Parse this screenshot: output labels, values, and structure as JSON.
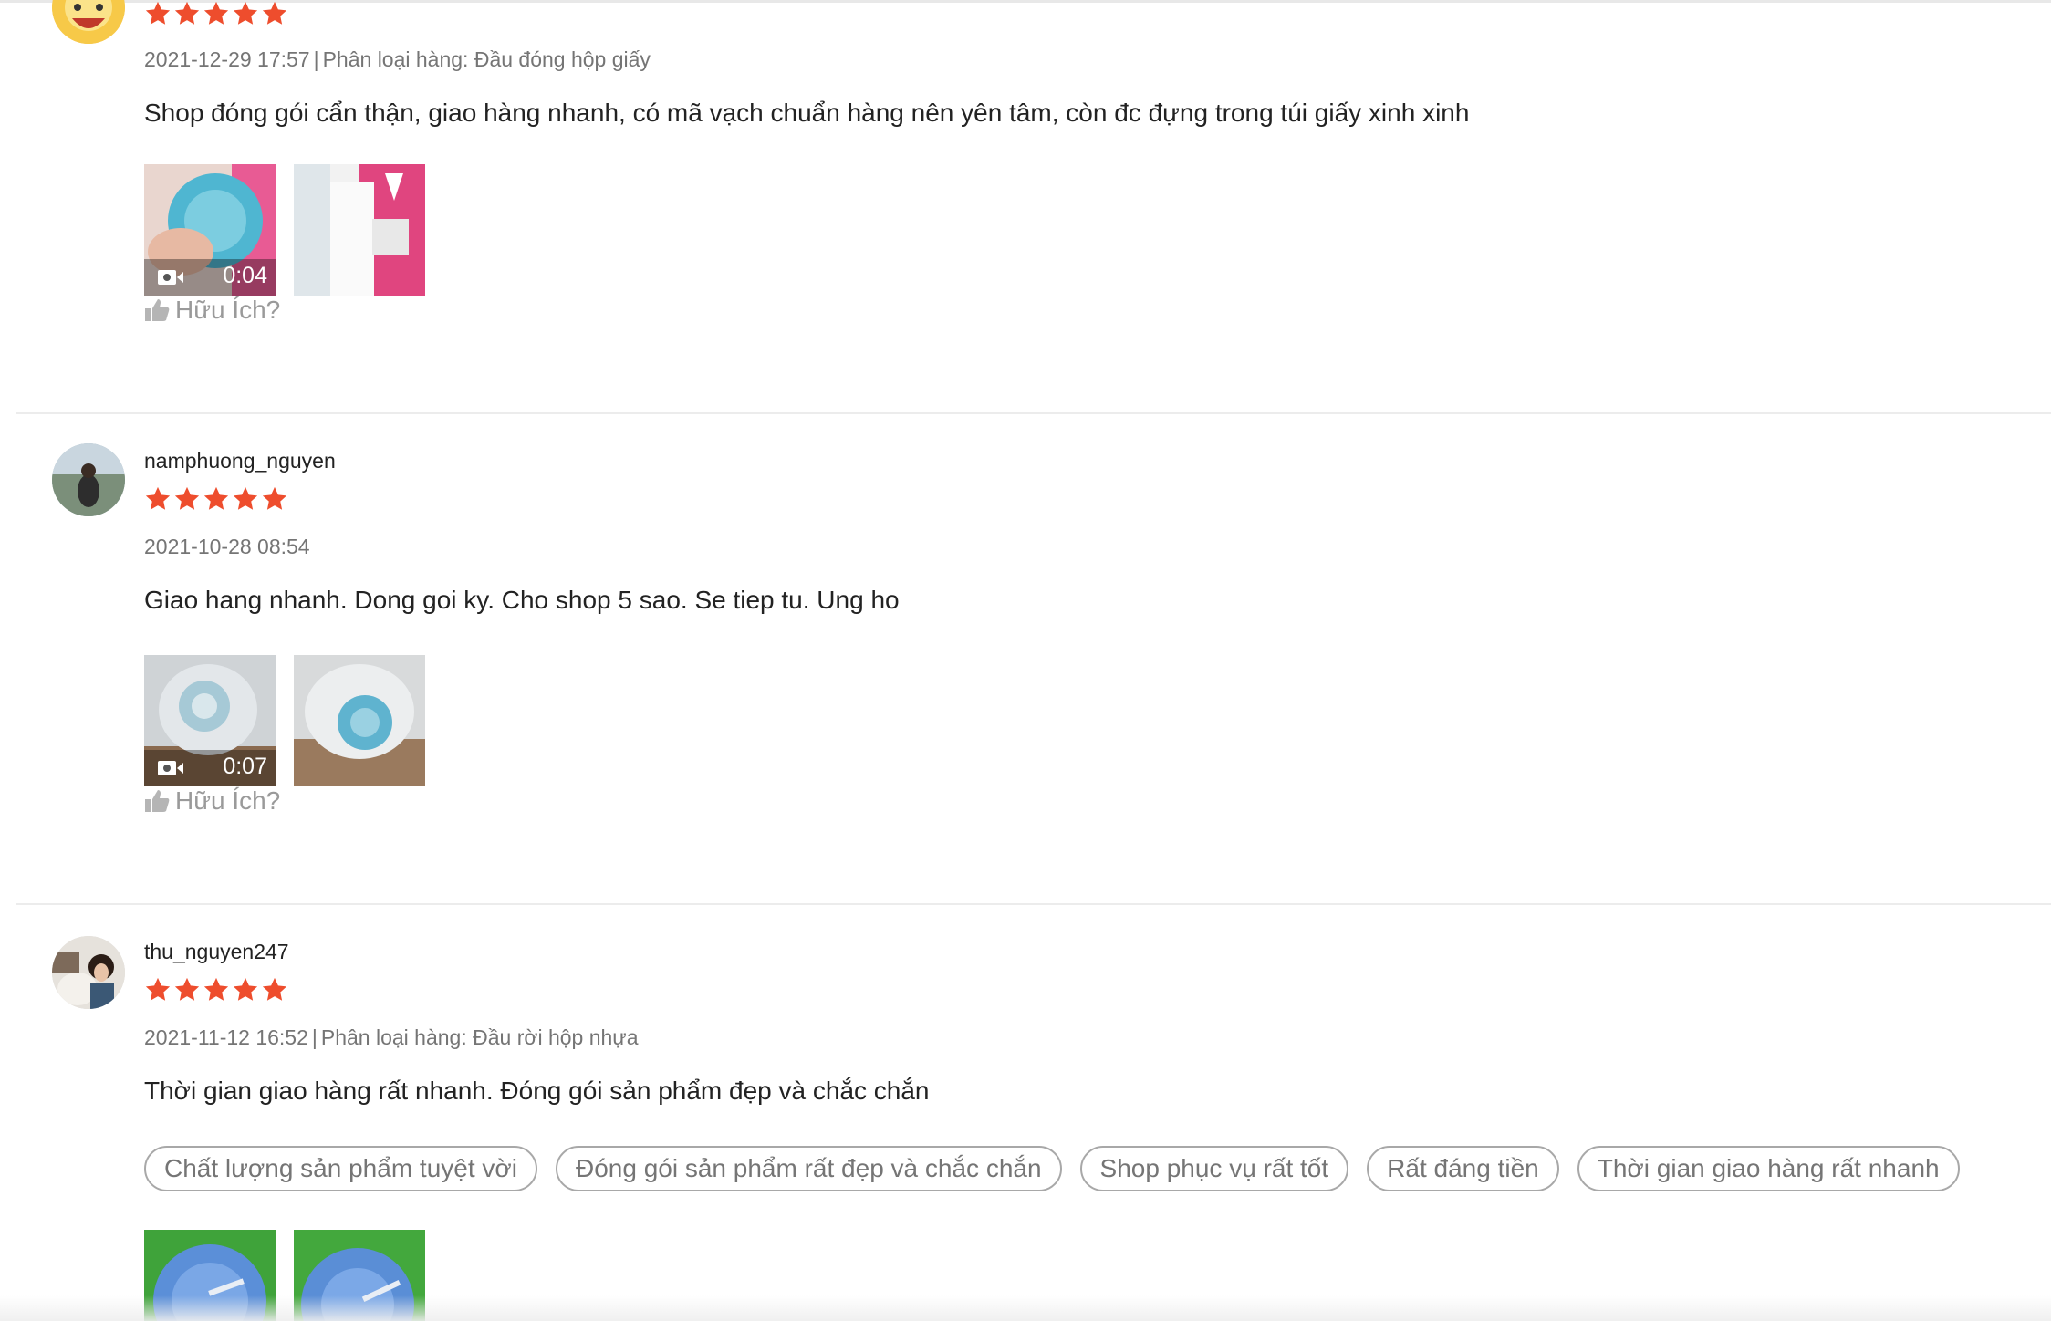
{
  "colors": {
    "star": "#ee4d2d",
    "meta_text": "#757575",
    "divider": "#ececec",
    "tag_border": "#a8a8a8",
    "helpful": "#9a9a9a"
  },
  "reviews": [
    {
      "username": "",
      "rating": 5,
      "date": "2021-12-29 17:57",
      "separator": "|",
      "variation": "Phân loại hàng: Đầu đóng hộp giấy",
      "comment": "Shop đóng gói cẩn thận, giao hàng nhanh, có mã vạch chuẩn hàng nên yên tâm, còn đc đựng trong túi giấy xinh xinh",
      "media": [
        {
          "type": "video",
          "duration": "0:04",
          "icon": "video-camera-icon"
        },
        {
          "type": "image"
        }
      ],
      "helpful_label": "Hữu Ích?"
    },
    {
      "username": "namphuong_nguyen",
      "rating": 5,
      "date": "2021-10-28 08:54",
      "comment": "Giao hang nhanh. Dong goi ky. Cho shop 5 sao. Se tiep tu. Ung ho",
      "media": [
        {
          "type": "video",
          "duration": "0:07",
          "icon": "video-camera-icon"
        },
        {
          "type": "image"
        }
      ],
      "helpful_label": "Hữu Ích?"
    },
    {
      "username": "thu_nguyen247",
      "rating": 5,
      "date": "2021-11-12 16:52",
      "separator": "|",
      "variation": "Phân loại hàng: Đầu rời hộp nhựa",
      "comment": "Thời gian giao hàng rất nhanh. Đóng gói sản phẩm  đẹp và chắc chắn",
      "tags": [
        "Chất lượng sản phẩm tuyệt vời",
        "Đóng gói sản phẩm rất đẹp và chắc chắn",
        "Shop phục vụ rất tốt",
        "Rất đáng tiền",
        "Thời gian giao hàng rất nhanh"
      ],
      "media": [
        {
          "type": "image"
        },
        {
          "type": "image"
        }
      ]
    }
  ]
}
